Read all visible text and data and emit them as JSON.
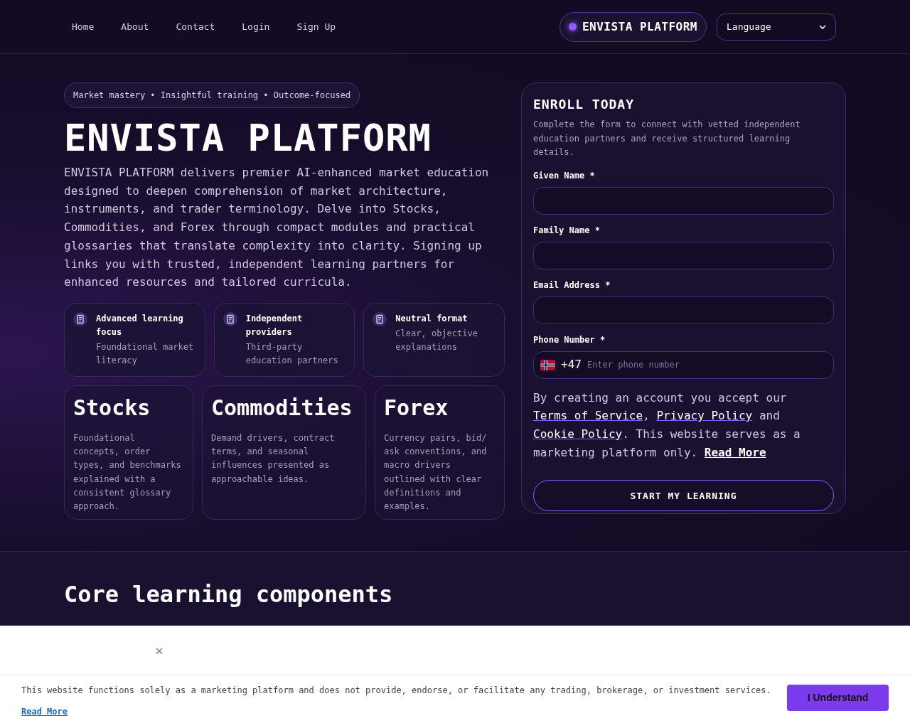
{
  "nav": {
    "links": [
      {
        "label": "Home"
      },
      {
        "label": "About"
      },
      {
        "label": "Contact"
      },
      {
        "label": "Login"
      },
      {
        "label": "Sign Up"
      }
    ],
    "brand": "ENVISTA PLATFORM",
    "language": {
      "placeholder": "Language"
    }
  },
  "hero": {
    "tagline": "Market mastery • Insightful training • Outcome-focused",
    "title": "ENVISTA PLATFORM",
    "description": "ENVISTA PLATFORM delivers premier AI-enhanced market education designed to deepen comprehension of market architecture, instruments, and trader terminology. Delve into Stocks, Commodities, and Forex through compact modules and practical glossaries that translate complexity into clarity. Signing up links you with trusted, independent learning partners for enhanced resources and tailored curricula.",
    "features": [
      {
        "title": "Advanced learning focus",
        "text": "Foundational market literacy"
      },
      {
        "title": "Independent providers",
        "text": "Third-party education partners"
      },
      {
        "title": "Neutral format",
        "text": "Clear, objective explanations"
      }
    ],
    "markets": [
      {
        "title": "Stocks",
        "text": "Foundational concepts, order types, and benchmarks explained with a consistent glossary approach."
      },
      {
        "title": "Commodities",
        "text": "Demand drivers, contract terms, and seasonal influences presented as approachable ideas."
      },
      {
        "title": "Forex",
        "text": "Currency pairs, bid/ ask conventions, and macro drivers outlined with clear definitions and examples."
      }
    ]
  },
  "enroll": {
    "title": "ENROLL TODAY",
    "description": "Complete the form to connect with vetted independent education partners and receive structured learning details.",
    "fields": [
      {
        "kind": "text",
        "label": "Given Name *"
      },
      {
        "kind": "text",
        "label": "Family Name *"
      },
      {
        "kind": "text",
        "label": "Email Address *"
      },
      {
        "kind": "phone",
        "label": "Phone Number *",
        "dial_code": "+47",
        "placeholder": "Enter phone number"
      }
    ],
    "consent": [
      {
        "kind": "text",
        "text": "By creating an account you accept our "
      },
      {
        "kind": "link",
        "text": "Terms of Service"
      },
      {
        "kind": "text",
        "text": ", "
      },
      {
        "kind": "link",
        "text": "Privacy Policy"
      },
      {
        "kind": "text",
        "text": " and "
      },
      {
        "kind": "link",
        "text": "Cookie Policy"
      },
      {
        "kind": "text",
        "text": ". This website serves as a marketing platform only. "
      },
      {
        "kind": "strong_link",
        "text": "Read More"
      }
    ],
    "button": "START MY LEARNING"
  },
  "section": {
    "title": "Core learning components"
  },
  "cookie": {
    "close": "×",
    "text": "This website functions solely as a marketing platform and does not provide, endorse, or facilitate any trading, brokerage, or investment services.",
    "read_more": "Read More",
    "button": "I Understand"
  }
}
